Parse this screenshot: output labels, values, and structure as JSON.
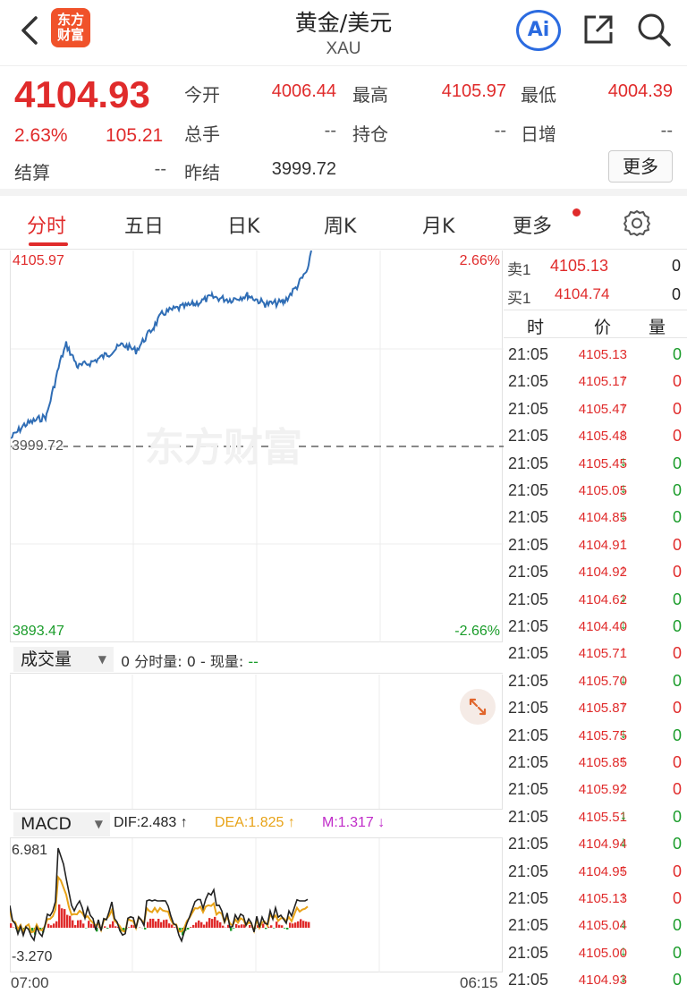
{
  "header": {
    "back_icon": "chevron-left-icon",
    "logo_text": "东方财富",
    "title": "黄金/美元",
    "symbol": "XAU",
    "ai_label": "Ai"
  },
  "quote": {
    "price": "4104.93",
    "change_pct": "2.63%",
    "change": "105.21",
    "open_label": "今开",
    "open": "4006.44",
    "high_label": "最高",
    "high": "4105.97",
    "low_label": "最低",
    "low": "4004.39",
    "volume_label": "总手",
    "volume": "--",
    "position_label": "持仓",
    "position": "--",
    "daily_inc_label": "日增",
    "daily_inc": "--",
    "settle_label": "结算",
    "settle": "--",
    "prev_settle_label": "昨结",
    "prev_settle": "3999.72",
    "more_label": "更多"
  },
  "tabs": [
    {
      "label": "分时",
      "active": true
    },
    {
      "label": "五日"
    },
    {
      "label": "日K"
    },
    {
      "label": "周K"
    },
    {
      "label": "月K"
    },
    {
      "label": "更多"
    }
  ],
  "chart": {
    "top_price": "4105.97",
    "top_pct": "2.66%",
    "base_price": "3999.72",
    "bottom_price": "3893.47",
    "bottom_pct": "-2.66%",
    "watermark": "东方财富",
    "start_time": "07:00",
    "end_time": "06:15"
  },
  "volume_panel": {
    "select_label": "成交量",
    "info": "0 分时量: 0 - 现量: ",
    "info_tail": "--"
  },
  "macd_panel": {
    "select_label": "MACD",
    "dif": "DIF:2.483 ↑",
    "dea": "DEA:1.825 ↑",
    "m": "M:1.317 ↓",
    "max": "6.981",
    "min": "-3.270"
  },
  "orderbook": {
    "sell_label": "卖1",
    "sell_price": "4105.13",
    "sell_qty": "0",
    "buy_label": "买1",
    "buy_price": "4104.74",
    "buy_qty": "0"
  },
  "ticks_header": {
    "time": "时",
    "price": "价",
    "qty": "量"
  },
  "ticks": [
    {
      "time": "21:05",
      "price": "4105.13",
      "arrow": "",
      "qty": "0",
      "qty_color": "green"
    },
    {
      "time": "21:05",
      "price": "4105.17",
      "arrow": "↑",
      "qty": "0",
      "qty_color": "red"
    },
    {
      "time": "21:05",
      "price": "4105.47",
      "arrow": "↑",
      "qty": "0",
      "qty_color": "red"
    },
    {
      "time": "21:05",
      "price": "4105.48",
      "arrow": "↑",
      "qty": "0",
      "qty_color": "red"
    },
    {
      "time": "21:05",
      "price": "4105.45",
      "arrow": "↓",
      "qty": "0",
      "qty_color": "green"
    },
    {
      "time": "21:05",
      "price": "4105.05",
      "arrow": "↓",
      "qty": "0",
      "qty_color": "green"
    },
    {
      "time": "21:05",
      "price": "4104.85",
      "arrow": "↓",
      "qty": "0",
      "qty_color": "green"
    },
    {
      "time": "21:05",
      "price": "4104.91",
      "arrow": "↑",
      "qty": "0",
      "qty_color": "red"
    },
    {
      "time": "21:05",
      "price": "4104.92",
      "arrow": "↑",
      "qty": "0",
      "qty_color": "red"
    },
    {
      "time": "21:05",
      "price": "4104.62",
      "arrow": "↓",
      "qty": "0",
      "qty_color": "green"
    },
    {
      "time": "21:05",
      "price": "4104.40",
      "arrow": "↓",
      "qty": "0",
      "qty_color": "green"
    },
    {
      "time": "21:05",
      "price": "4105.71",
      "arrow": "↑",
      "qty": "0",
      "qty_color": "red"
    },
    {
      "time": "21:05",
      "price": "4105.70",
      "arrow": "↓",
      "qty": "0",
      "qty_color": "green"
    },
    {
      "time": "21:05",
      "price": "4105.87",
      "arrow": "↑",
      "qty": "0",
      "qty_color": "red"
    },
    {
      "time": "21:05",
      "price": "4105.75",
      "arrow": "↓",
      "qty": "0",
      "qty_color": "green"
    },
    {
      "time": "21:05",
      "price": "4105.85",
      "arrow": "↑",
      "qty": "0",
      "qty_color": "red"
    },
    {
      "time": "21:05",
      "price": "4105.92",
      "arrow": "↑",
      "qty": "0",
      "qty_color": "red"
    },
    {
      "time": "21:05",
      "price": "4105.51",
      "arrow": "↓",
      "qty": "0",
      "qty_color": "green"
    },
    {
      "time": "21:05",
      "price": "4104.94",
      "arrow": "↓",
      "qty": "0",
      "qty_color": "green"
    },
    {
      "time": "21:05",
      "price": "4104.95",
      "arrow": "↑",
      "qty": "0",
      "qty_color": "red"
    },
    {
      "time": "21:05",
      "price": "4105.13",
      "arrow": "↑",
      "qty": "0",
      "qty_color": "red"
    },
    {
      "time": "21:05",
      "price": "4105.04",
      "arrow": "↓",
      "qty": "0",
      "qty_color": "green"
    },
    {
      "time": "21:05",
      "price": "4105.00",
      "arrow": "↓",
      "qty": "0",
      "qty_color": "green"
    },
    {
      "time": "21:05",
      "price": "4104.93",
      "arrow": "↓",
      "qty": "0",
      "qty_color": "green"
    }
  ],
  "colors": {
    "up": "#e02b2b",
    "down": "#1a9c2a",
    "line": "#2f6db5",
    "accent": "#f0522a"
  }
}
